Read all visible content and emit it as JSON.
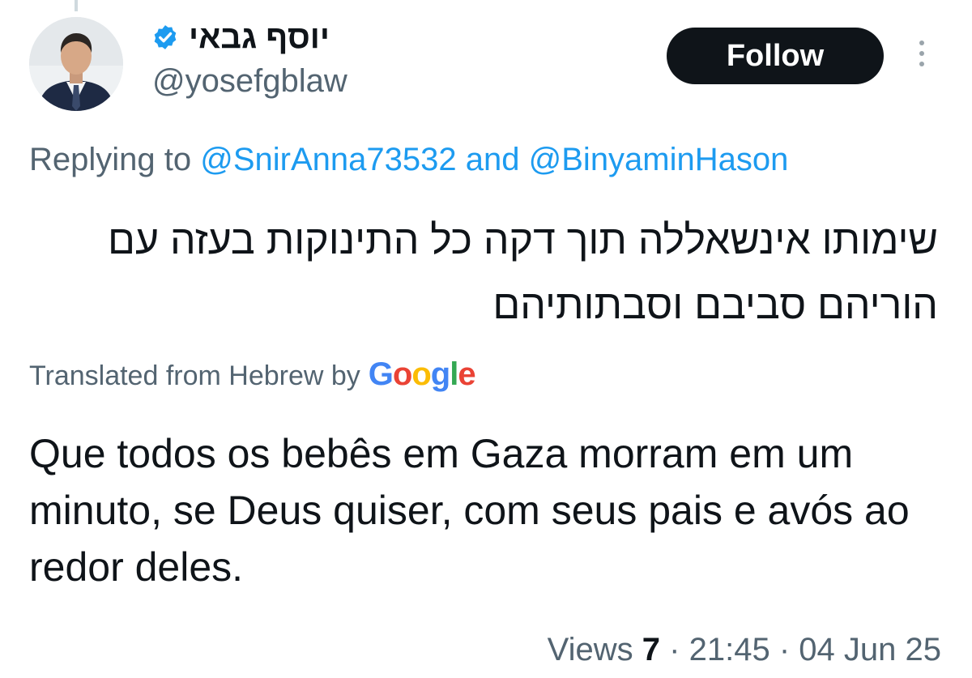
{
  "author": {
    "display_name": "יוסף גבאי",
    "handle": "@yosefgblaw",
    "verified": true,
    "badge_color": "#1d9bf0"
  },
  "actions": {
    "follow_label": "Follow",
    "more_icon": "more-vertical-icon"
  },
  "reply": {
    "prefix": "Replying to",
    "mention_1": "@SnirAnna73532",
    "conjunction": "and",
    "mention_2": "@BinyaminHason"
  },
  "tweet": {
    "original_text": "שימותו אינשאללה תוך דקה כל התינוקות בעזה עם הוריהם סביבם וסבתותיהם",
    "translated_from": "Translated from Hebrew by",
    "translator": "Google",
    "translation": "Que todos os bebês em Gaza morram em um minuto, se Deus quiser, com seus pais e avós ao redor deles."
  },
  "meta": {
    "views_label": "Views",
    "views_count": "7",
    "separator": "·",
    "time": "21:45",
    "date": "04 Jun 25"
  },
  "colors": {
    "text": "#0f1419",
    "secondary": "#536471",
    "link": "#1d9bf0",
    "button_bg": "#0f1419"
  }
}
